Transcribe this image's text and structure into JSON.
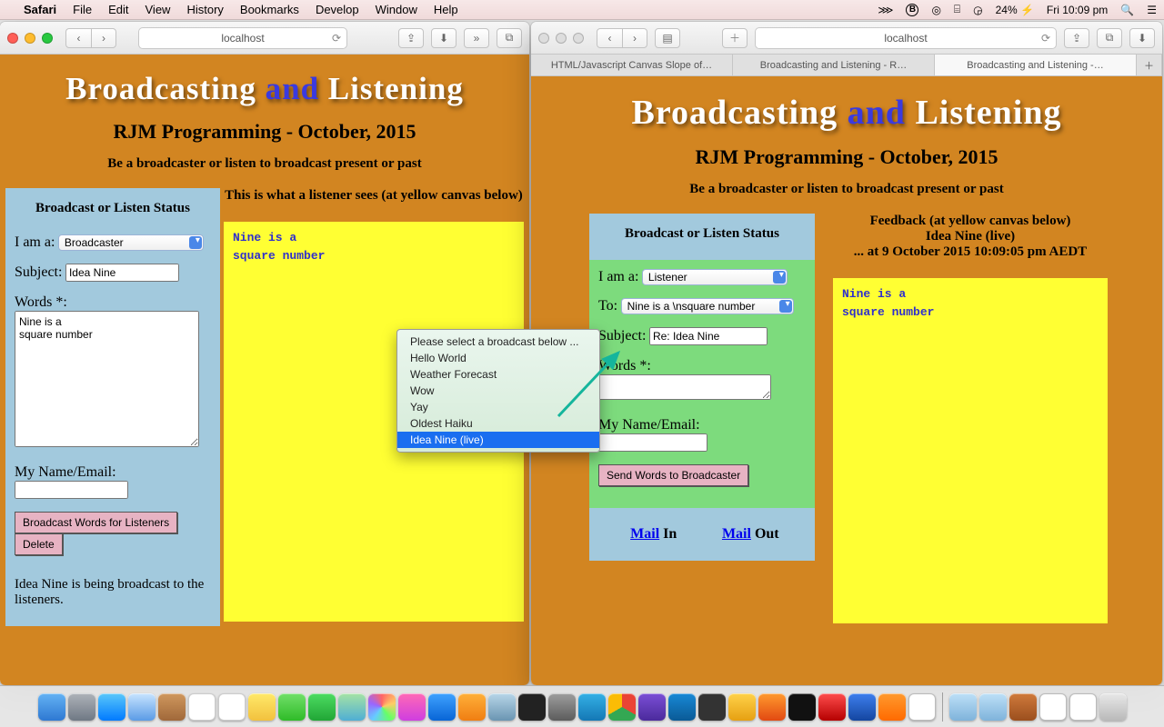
{
  "menubar": {
    "apple": "",
    "app": "Safari",
    "items": [
      "File",
      "Edit",
      "View",
      "History",
      "Bookmarks",
      "Develop",
      "Window",
      "Help"
    ],
    "battery": "24%",
    "clock": "Fri 10:09 pm"
  },
  "windowLeft": {
    "url": "localhost",
    "traffic": "color"
  },
  "windowRight": {
    "url": "localhost",
    "traffic": "grey",
    "tabs": [
      "HTML/Javascript Canvas Slope of…",
      "Broadcasting and Listening - R…",
      "Broadcasting and Listening -…"
    ],
    "activeTab": 2
  },
  "page": {
    "title_a": "Broadcasting ",
    "title_and": "and",
    "title_b": " Listening",
    "sub1": "RJM Programming - October, 2015",
    "sub2": "Be a broadcaster or listen to broadcast present or past"
  },
  "left": {
    "panel_title": "Broadcast or Listen Status",
    "iam_label": "I am a:",
    "iam_value": "Broadcaster",
    "subject_label": "Subject:",
    "subject_value": "Idea Nine",
    "words_label": "Words *:",
    "words_value": "Nine is a\nsquare number",
    "name_label": "My Name/Email:",
    "name_value": "",
    "btn_broadcast": "Broadcast Words for Listeners",
    "btn_delete": "Delete",
    "status_msg": "Idea Nine is being broadcast to the listeners.",
    "right_info": "This is what a listener sees (at yellow canvas below)",
    "canvas_line1": "Nine is a",
    "canvas_line2": "square number"
  },
  "right": {
    "panel_title": "Broadcast or Listen Status",
    "iam_label": "I am a:",
    "iam_value": "Listener",
    "to_label": "To:",
    "to_value": "Nine is a \\nsquare number",
    "subject_label": "Subject:",
    "subject_value": "Re: Idea Nine",
    "words_label": "Words *:",
    "words_value": "",
    "name_label": "My Name/Email:",
    "name_value": "",
    "btn_send": "Send Words to Broadcaster",
    "mail_in_link": "Mail",
    "mail_in_rest": " In",
    "mail_out_link": "Mail",
    "mail_out_rest": " Out",
    "right_info_l1": "Feedback (at yellow canvas below)",
    "right_info_l2": "Idea Nine (live)",
    "right_info_l3": "... at 9 October 2015 10:09:05 pm AEDT",
    "canvas_line1": "Nine is a",
    "canvas_line2": "square number"
  },
  "dropdown": {
    "prompt": "Please select a broadcast below ...",
    "options": [
      "Hello World",
      "Weather Forecast",
      "Wow",
      "Yay",
      "Oldest Haiku",
      "Idea Nine (live)"
    ],
    "selected": "Idea Nine (live)"
  }
}
